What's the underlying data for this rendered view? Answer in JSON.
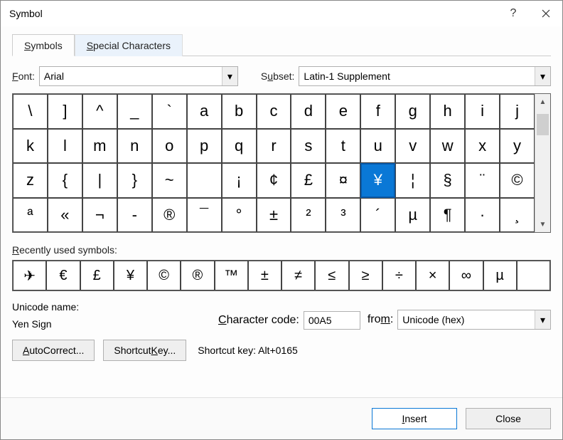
{
  "title": "Symbol",
  "tabs": {
    "symbols": "Symbols",
    "special": "Special Characters"
  },
  "font": {
    "label": "Font:",
    "value": "Arial"
  },
  "subset": {
    "label": "Subset:",
    "value": "Latin-1 Supplement"
  },
  "grid": {
    "rows": [
      [
        "\\",
        "]",
        "^",
        "_",
        "`",
        "a",
        "b",
        "c",
        "d",
        "e",
        "f",
        "g",
        "h",
        "i",
        "j"
      ],
      [
        "k",
        "l",
        "m",
        "n",
        "o",
        "p",
        "q",
        "r",
        "s",
        "t",
        "u",
        "v",
        "w",
        "x",
        "y"
      ],
      [
        "z",
        "{",
        "|",
        "}",
        "~",
        "",
        "¡",
        "¢",
        "£",
        "¤",
        "¥",
        "¦",
        "§",
        "¨",
        "©"
      ],
      [
        "ª",
        "«",
        "¬",
        "-",
        "®",
        "¯",
        "°",
        "±",
        "²",
        "³",
        "´",
        "µ",
        "¶",
        "·",
        "¸"
      ]
    ],
    "selected": "¥"
  },
  "recent": {
    "label": "Recently used symbols:",
    "items": [
      "✈",
      "€",
      "£",
      "¥",
      "©",
      "®",
      "™",
      "±",
      "≠",
      "≤",
      "≥",
      "÷",
      "×",
      "∞",
      "µ",
      ""
    ]
  },
  "unicode": {
    "label": "Unicode name:",
    "value": "Yen Sign"
  },
  "charcode": {
    "label": "Character code:",
    "value": "00A5"
  },
  "from": {
    "label": "from:",
    "value": "Unicode (hex)"
  },
  "buttons": {
    "autocorrect": "AutoCorrect...",
    "shortcutkey": "Shortcut Key..."
  },
  "shortcut": {
    "label": "Shortcut key: Alt+0165"
  },
  "footer": {
    "insert": "Insert",
    "close": "Close"
  }
}
